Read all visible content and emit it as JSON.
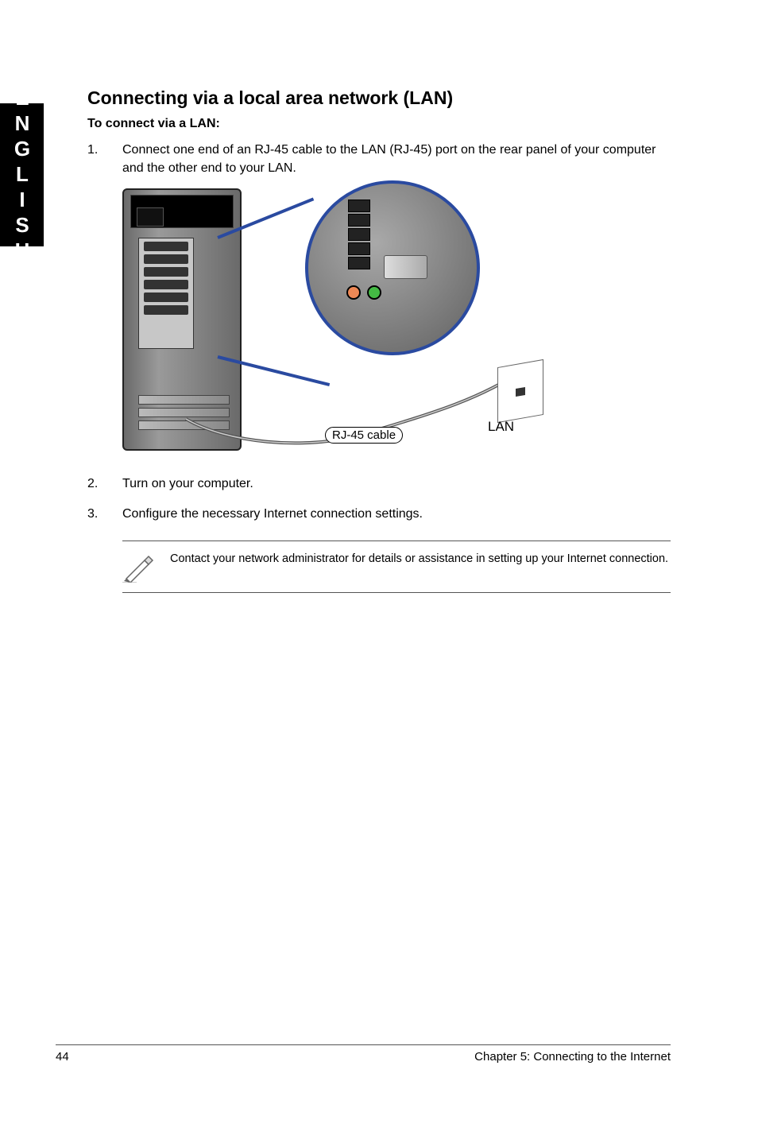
{
  "sideTab": "ENGLISH",
  "heading": "Connecting via a local area network (LAN)",
  "subheading": "To connect via a LAN:",
  "steps": [
    {
      "num": "1.",
      "text": "Connect one end of an RJ-45 cable to the LAN (RJ-45) port on the rear panel of your computer and the other end to your LAN."
    },
    {
      "num": "2.",
      "text": "Turn on your computer."
    },
    {
      "num": "3.",
      "text": "Configure the necessary Internet connection settings."
    }
  ],
  "figure": {
    "cableLabel": "RJ-45 cable",
    "lanLabel": "LAN"
  },
  "note": "Contact your network administrator for details or assistance in setting up your Internet connection.",
  "footer": {
    "page": "44",
    "chapter": "Chapter 5: Connecting to the Internet"
  }
}
